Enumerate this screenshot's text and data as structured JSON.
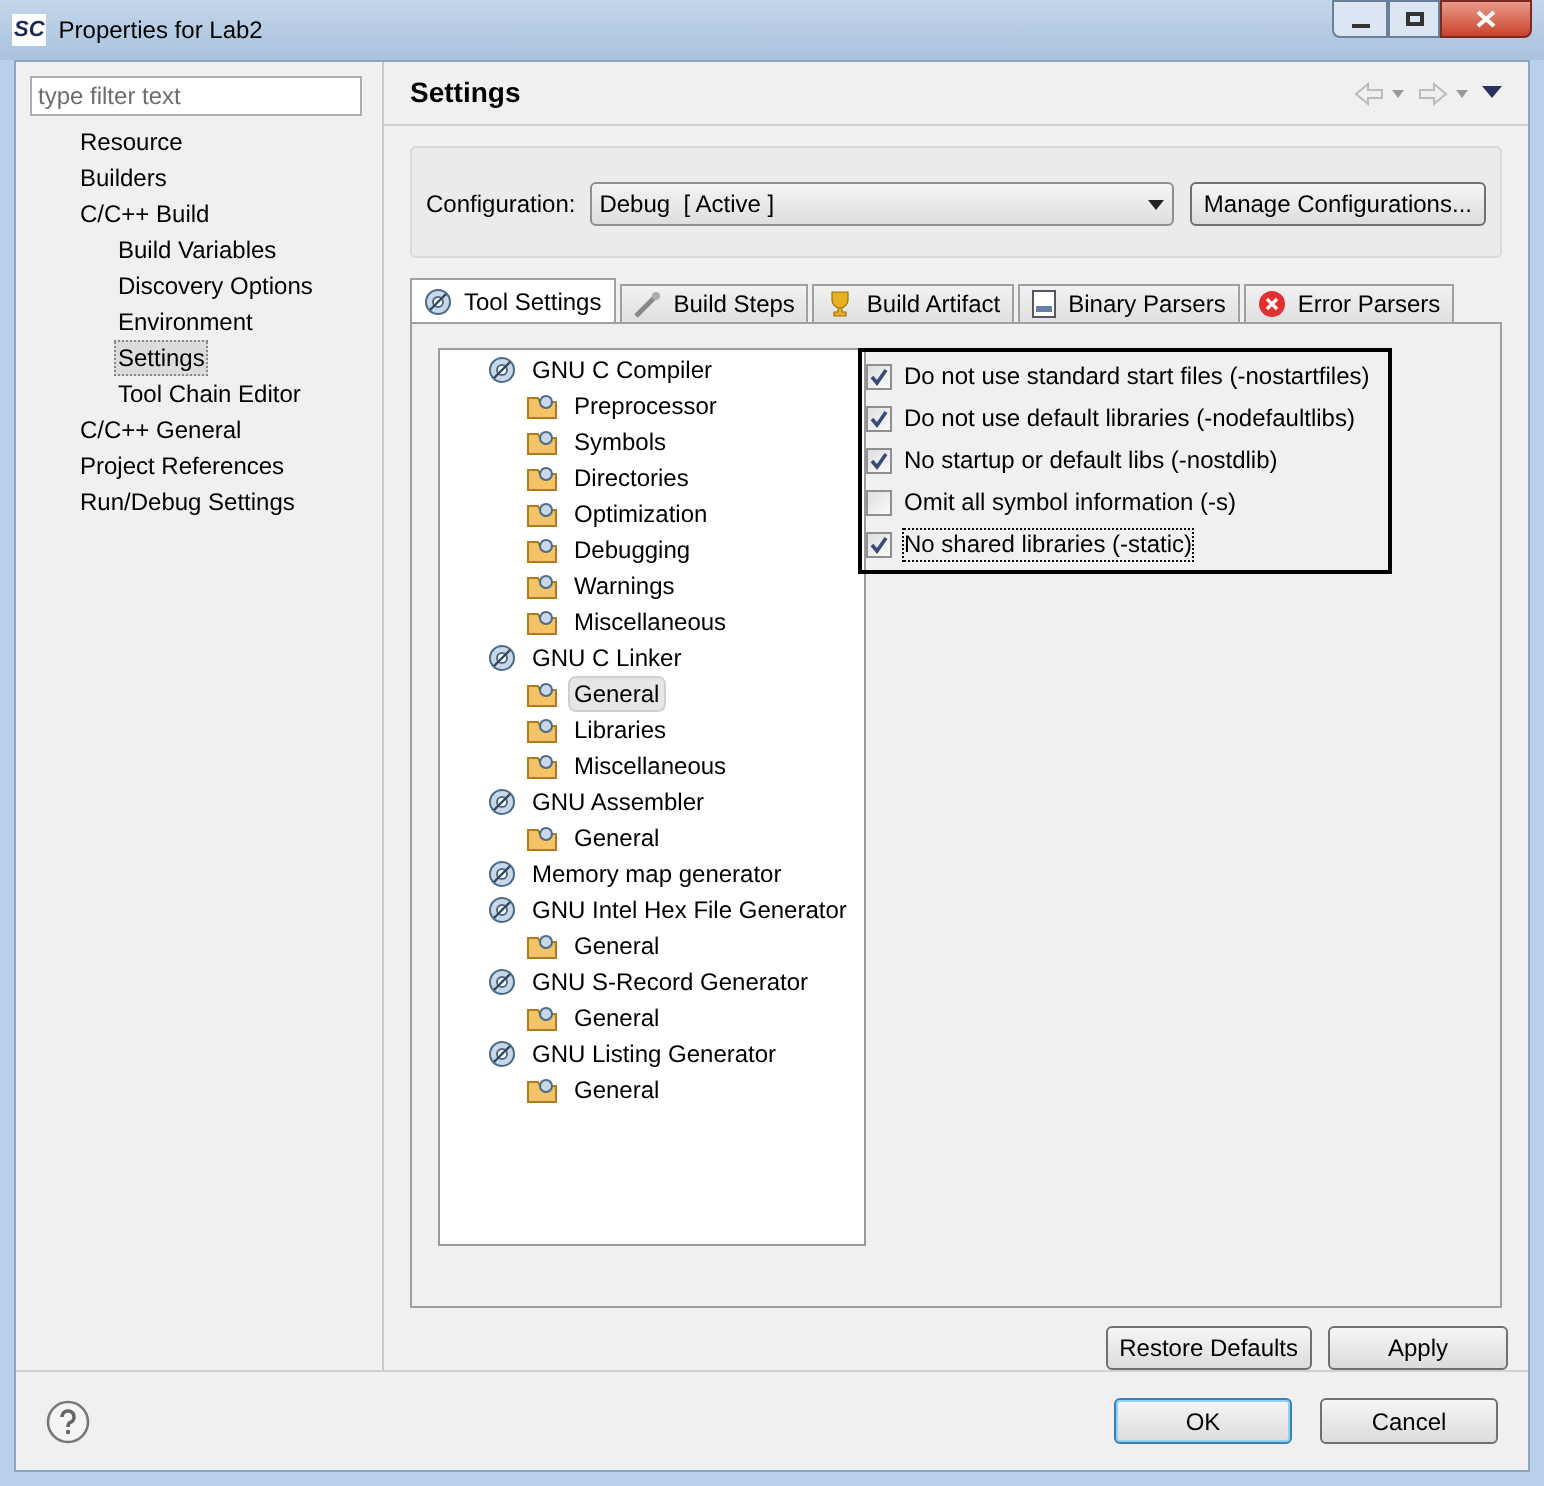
{
  "window": {
    "title": "Properties for Lab2",
    "logo": "SC"
  },
  "filter": {
    "placeholder": "type filter text"
  },
  "sidebar": {
    "items": [
      {
        "label": "Resource",
        "selected": false
      },
      {
        "label": "Builders",
        "selected": false
      },
      {
        "label": "C/C++ Build",
        "selected": false,
        "children": [
          {
            "label": "Build Variables",
            "selected": false
          },
          {
            "label": "Discovery Options",
            "selected": false
          },
          {
            "label": "Environment",
            "selected": false
          },
          {
            "label": "Settings",
            "selected": true
          },
          {
            "label": "Tool Chain Editor",
            "selected": false
          }
        ]
      },
      {
        "label": "C/C++ General",
        "selected": false
      },
      {
        "label": "Project References",
        "selected": false
      },
      {
        "label": "Run/Debug Settings",
        "selected": false
      }
    ]
  },
  "page": {
    "title": "Settings"
  },
  "configuration": {
    "label": "Configuration:",
    "value": "Debug  [ Active ]",
    "button": "Manage Configurations..."
  },
  "tabs": [
    {
      "label": "Tool Settings",
      "selected": true
    },
    {
      "label": "Build Steps",
      "selected": false
    },
    {
      "label": "Build Artifact",
      "selected": false
    },
    {
      "label": "Binary Parsers",
      "selected": false
    },
    {
      "label": "Error Parsers",
      "selected": false
    }
  ],
  "tool_tree": [
    {
      "label": "GNU C Compiler",
      "selected": false,
      "children": [
        {
          "label": "Preprocessor",
          "selected": false
        },
        {
          "label": "Symbols",
          "selected": false
        },
        {
          "label": "Directories",
          "selected": false
        },
        {
          "label": "Optimization",
          "selected": false
        },
        {
          "label": "Debugging",
          "selected": false
        },
        {
          "label": "Warnings",
          "selected": false
        },
        {
          "label": "Miscellaneous",
          "selected": false
        }
      ]
    },
    {
      "label": "GNU C Linker",
      "selected": false,
      "children": [
        {
          "label": "General",
          "selected": true
        },
        {
          "label": "Libraries",
          "selected": false
        },
        {
          "label": "Miscellaneous",
          "selected": false
        }
      ]
    },
    {
      "label": "GNU Assembler",
      "selected": false,
      "children": [
        {
          "label": "General",
          "selected": false
        }
      ]
    },
    {
      "label": "Memory map generator",
      "selected": false
    },
    {
      "label": "GNU Intel Hex File Generator",
      "selected": false,
      "children": [
        {
          "label": "General",
          "selected": false
        }
      ]
    },
    {
      "label": "GNU S-Record Generator",
      "selected": false,
      "children": [
        {
          "label": "General",
          "selected": false
        }
      ]
    },
    {
      "label": "GNU Listing Generator",
      "selected": false,
      "children": [
        {
          "label": "General",
          "selected": false
        }
      ]
    }
  ],
  "options": [
    {
      "label": "Do not use standard start files (-nostartfiles)",
      "checked": true,
      "focused": false
    },
    {
      "label": "Do not use default libraries (-nodefaultlibs)",
      "checked": true,
      "focused": false
    },
    {
      "label": "No startup or default libs (-nostdlib)",
      "checked": true,
      "focused": false
    },
    {
      "label": "Omit all symbol information (-s)",
      "checked": false,
      "focused": false
    },
    {
      "label": "No shared libraries (-static)",
      "checked": true,
      "focused": true
    }
  ],
  "page_buttons": [
    "Restore Defaults",
    "Apply"
  ],
  "dialog_buttons": [
    {
      "label": "OK",
      "default": true
    },
    {
      "label": "Cancel",
      "default": false
    }
  ]
}
